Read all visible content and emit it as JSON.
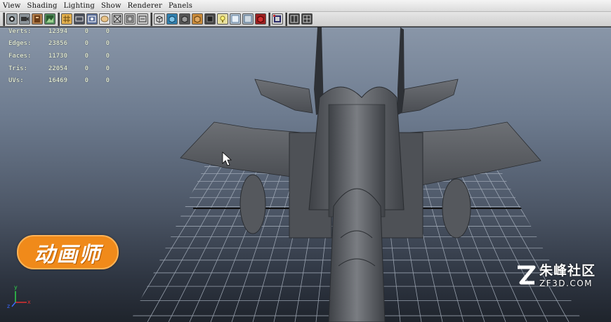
{
  "menu": {
    "items": [
      "View",
      "Shading",
      "Lighting",
      "Show",
      "Renderer",
      "Panels"
    ]
  },
  "toolbar": {
    "icons": [
      "select-camera-icon",
      "camera-attributes-icon",
      "bookmarks-icon",
      "image-plane-icon",
      "grid-icon",
      "film-gate-icon",
      "resolution-gate-icon",
      "gate-mask-icon",
      "field-chart-icon",
      "safe-action-icon",
      "safe-title-icon",
      "wireframe-icon",
      "smooth-shade-icon",
      "textured-icon",
      "use-lights-icon",
      "shadows-icon",
      "xray-icon",
      "isolate-select-icon",
      "hardware-texture-icon",
      "default-lighting-icon",
      "resolution-gate-toggle-icon",
      "two-pane-icon",
      "four-pane-icon"
    ]
  },
  "hud": {
    "rows": [
      {
        "label": "Verts:",
        "value": "12394",
        "a": "0",
        "b": "0"
      },
      {
        "label": "Edges:",
        "value": "23856",
        "a": "0",
        "b": "0"
      },
      {
        "label": "Faces:",
        "value": "11730",
        "a": "0",
        "b": "0"
      },
      {
        "label": "Tris:",
        "value": "22054",
        "a": "0",
        "b": "0"
      },
      {
        "label": "UVs:",
        "value": "16469",
        "a": "0",
        "b": "0"
      }
    ]
  },
  "axis": {
    "x": "x",
    "y": "y",
    "z": "z"
  },
  "badge": {
    "text": "动画师"
  },
  "watermark": {
    "cn": "朱峰社区",
    "en": "ZF3D.COM"
  },
  "colors": {
    "accent_orange": "#f08a1a",
    "viewport_top": "#8996a8",
    "viewport_bottom": "#1f242c",
    "aircraft": "#5b5e63",
    "grid": "#aab3c0"
  }
}
